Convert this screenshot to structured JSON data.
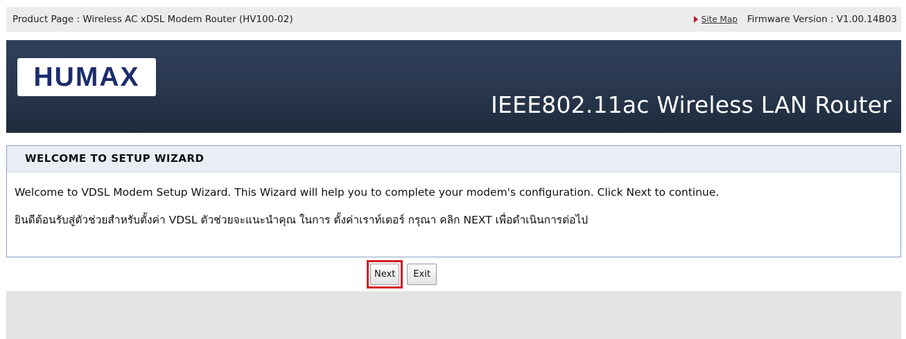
{
  "topbar": {
    "product_label": "Product Page : Wireless AC xDSL Modem Router (HV100-02)",
    "site_map": "Site Map",
    "firmware": "Firmware Version : V1.00.14B03"
  },
  "header": {
    "logo_text": "HUMAX",
    "product_title": "IEEE802.11ac Wireless LAN Router"
  },
  "panel": {
    "title": "WELCOME TO SETUP WIZARD",
    "text_en": "Welcome to VDSL Modem Setup Wizard. This Wizard will help you to complete your modem's configuration. Click Next to continue.",
    "text_th": "ยินดีต้อนรับสู่ตัวช่วยสำหรับตั้งค่า VDSL ตัวช่วยจะแนะนำคุณ ในการ ตั้งค่าเราท์เตอร์ กรุณา คลิก NEXT เพื่อดำเนินการต่อไป"
  },
  "buttons": {
    "next": "Next",
    "exit": "Exit"
  },
  "colors": {
    "header_bg": "#2a3950",
    "logo_text": "#1c2d6e",
    "highlight": "#d41c24",
    "panel_border": "#8aa1c4"
  }
}
